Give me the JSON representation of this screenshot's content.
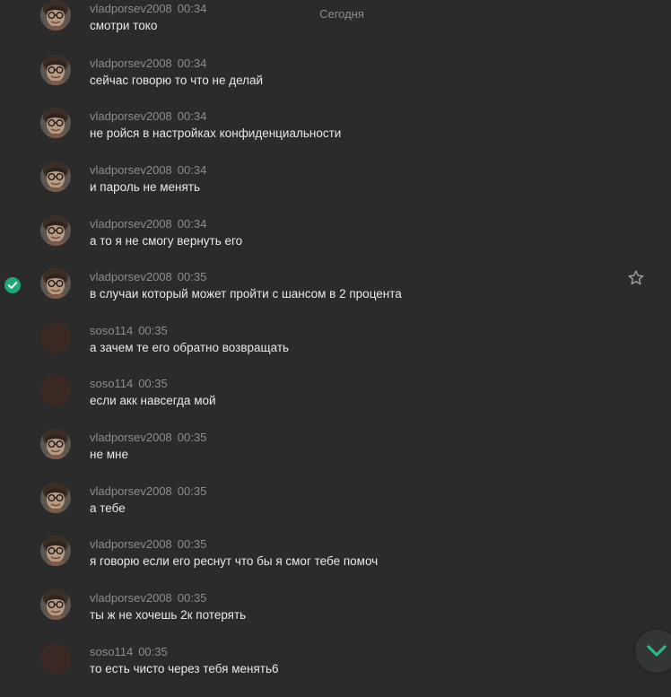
{
  "date_separator": "Сегодня",
  "colors": {
    "background": "#2b2b2b",
    "accent": "#1fa67a",
    "author": "#8c8c8c",
    "text": "#e8e8e8"
  },
  "messages": [
    {
      "author": "vladporsev2008",
      "time": "00:34",
      "text": "смотри токо",
      "avatar": "vlad"
    },
    {
      "author": "vladporsev2008",
      "time": "00:34",
      "text": "сейчас говорю то что не делай",
      "avatar": "vlad"
    },
    {
      "author": "vladporsev2008",
      "time": "00:34",
      "text": "не ройся в настройках конфиденциальности",
      "avatar": "vlad"
    },
    {
      "author": "vladporsev2008",
      "time": "00:34",
      "text": "и пароль не менять",
      "avatar": "vlad"
    },
    {
      "author": "vladporsev2008",
      "time": "00:34",
      "text": "а то я не смогу вернуть его",
      "avatar": "vlad"
    },
    {
      "author": "vladporsev2008",
      "time": "00:35",
      "text": "в случаи который может пройти с шансом в 2 процента",
      "avatar": "vlad",
      "selected": true
    },
    {
      "author": "soso114",
      "time": "00:35",
      "text": "а зачем те его обратно возвращать",
      "avatar": "soso"
    },
    {
      "author": "soso114",
      "time": "00:35",
      "text": "если акк навсегда мой",
      "avatar": "soso"
    },
    {
      "author": "vladporsev2008",
      "time": "00:35",
      "text": "не мне",
      "avatar": "vlad"
    },
    {
      "author": "vladporsev2008",
      "time": "00:35",
      "text": "а тебе",
      "avatar": "vlad"
    },
    {
      "author": "vladporsev2008",
      "time": "00:35",
      "text": "я говорю если его реснут что бы я смог тебе помоч",
      "avatar": "vlad"
    },
    {
      "author": "vladporsev2008",
      "time": "00:35",
      "text": "ты ж не хочешь 2к потерять",
      "avatar": "vlad"
    },
    {
      "author": "soso114",
      "time": "00:35",
      "text": "то есть чисто через тебя менять6",
      "avatar": "soso"
    }
  ],
  "icons": {
    "selected_check": "check-circle-icon",
    "favorite": "star-icon",
    "scroll_down": "chevron-down-icon"
  }
}
